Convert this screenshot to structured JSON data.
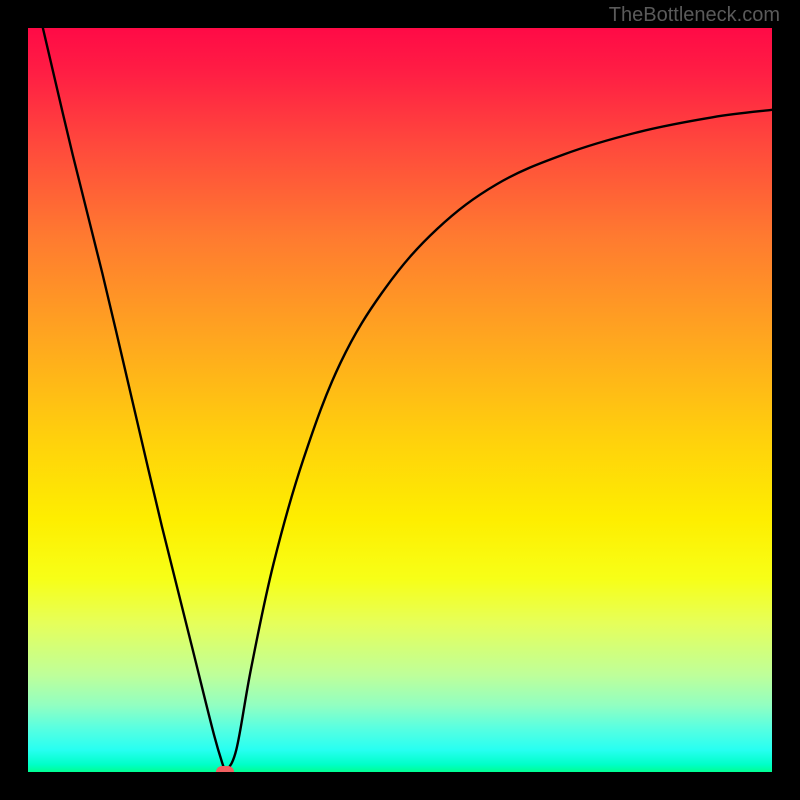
{
  "watermark": "TheBottleneck.com",
  "chart_data": {
    "type": "line",
    "title": "",
    "xlabel": "",
    "ylabel": "",
    "xlim": [
      0,
      100
    ],
    "ylim": [
      0,
      100
    ],
    "gradient_stops": [
      {
        "pct": 0,
        "color": "#ff0a46"
      },
      {
        "pct": 16,
        "color": "#ff4a3c"
      },
      {
        "pct": 42,
        "color": "#ffa71f"
      },
      {
        "pct": 66,
        "color": "#feee00"
      },
      {
        "pct": 87,
        "color": "#beff9a"
      },
      {
        "pct": 100,
        "color": "#00ff92"
      }
    ],
    "series": [
      {
        "name": "bottleneck-curve",
        "points": [
          {
            "x": 2,
            "y": 100
          },
          {
            "x": 6,
            "y": 83
          },
          {
            "x": 10,
            "y": 67
          },
          {
            "x": 14,
            "y": 50
          },
          {
            "x": 18,
            "y": 33
          },
          {
            "x": 22,
            "y": 17
          },
          {
            "x": 25,
            "y": 5
          },
          {
            "x": 26.5,
            "y": 0
          },
          {
            "x": 28,
            "y": 3
          },
          {
            "x": 30,
            "y": 14
          },
          {
            "x": 33,
            "y": 28
          },
          {
            "x": 37,
            "y": 42
          },
          {
            "x": 42,
            "y": 55
          },
          {
            "x": 48,
            "y": 65
          },
          {
            "x": 55,
            "y": 73
          },
          {
            "x": 63,
            "y": 79
          },
          {
            "x": 72,
            "y": 83
          },
          {
            "x": 82,
            "y": 86
          },
          {
            "x": 92,
            "y": 88
          },
          {
            "x": 100,
            "y": 89
          }
        ]
      }
    ],
    "marker": {
      "x": 26.5,
      "y": 0,
      "color": "#f06060"
    }
  }
}
